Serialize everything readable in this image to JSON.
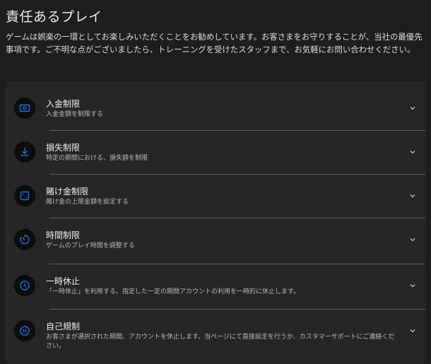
{
  "page": {
    "title": "責任あるプレイ",
    "intro": "ゲームは娯楽の一環としてお楽しみいただくことをお勧めしています。お客さまをお守りすることが、当社の最優先事項です。ご不明な点がございましたら、トレーニングを受けたスタッフまで、お気軽にお問い合わせください。"
  },
  "items": [
    {
      "title": "入金制限",
      "desc": "入金金額を制限する",
      "icon": "cash-icon"
    },
    {
      "title": "損失制限",
      "desc": "特定の期間における、損失額を制限",
      "icon": "download-icon"
    },
    {
      "title": "賭け金制限",
      "desc": "賭け金の上限金額を設定する",
      "icon": "dice-icon"
    },
    {
      "title": "時間制限",
      "desc": "ゲームのプレイ時間を調整する",
      "icon": "timer-icon"
    },
    {
      "title": "一時休止",
      "desc": "「一時休止」を利用する。指定した一定の期間アカウントの利用を一時的に休止します。",
      "icon": "clock-icon"
    },
    {
      "title": "自己規制",
      "desc": "お客さまが選択された期間、アカウントを休止します。当ページにて直接設定を行うか、カスタマーサポートにご連絡ください。",
      "icon": "pause-icon"
    }
  ],
  "colors": {
    "accent": "#1a6fe0",
    "background": "#1e1e1e",
    "panel": "#262626"
  }
}
